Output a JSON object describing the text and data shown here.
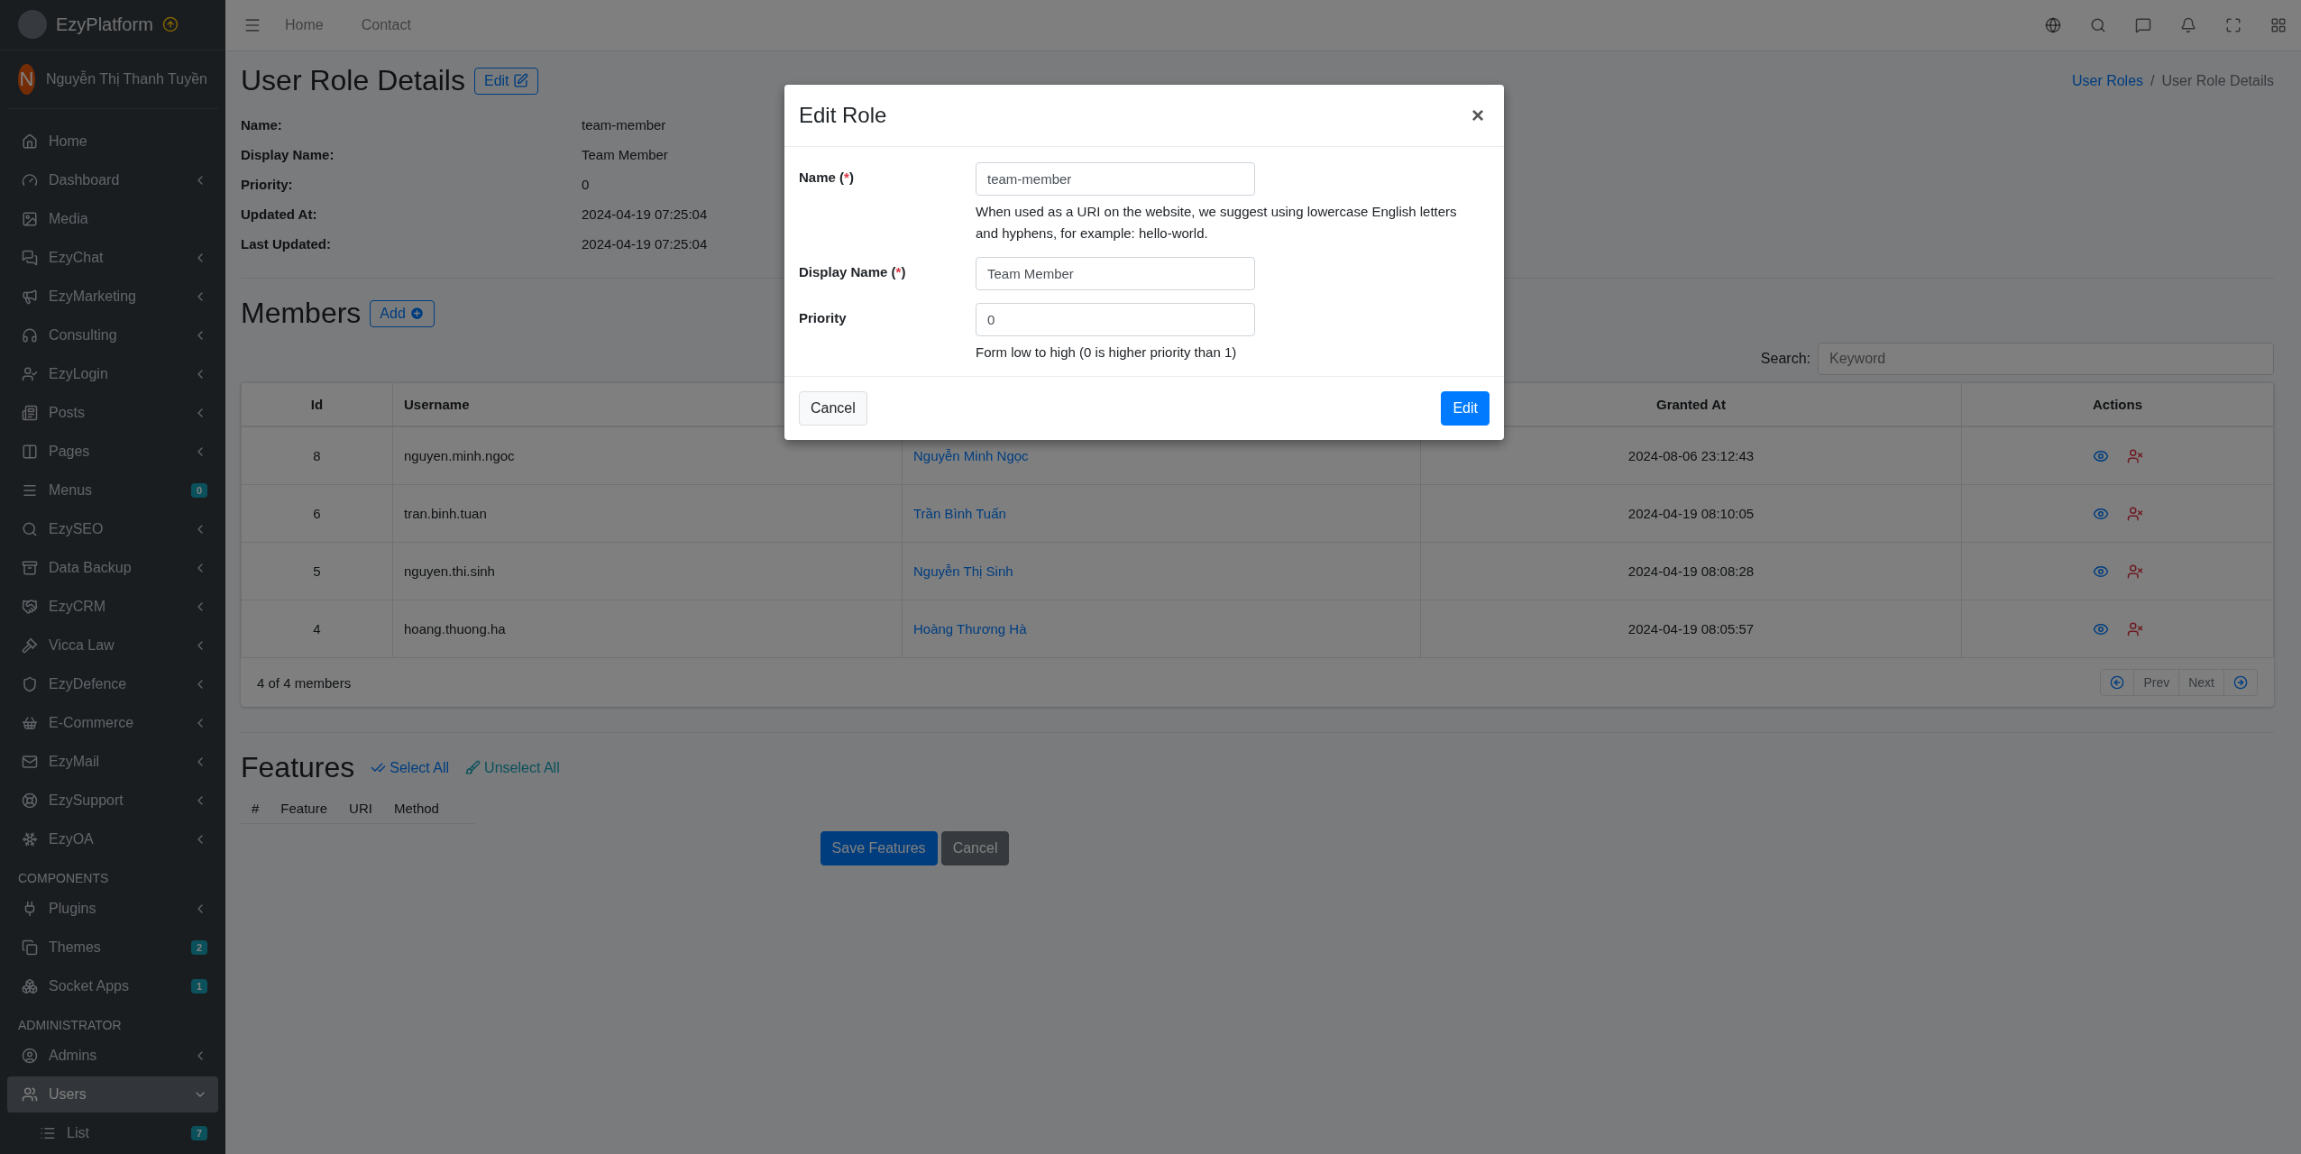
{
  "sidebar": {
    "brand": "EzyPlatform",
    "user": {
      "initial": "N",
      "name": "Nguyễn Thị Thanh Tuyền"
    },
    "groups": [
      {
        "items": [
          {
            "label": "Home",
            "expandable": false,
            "selected": false
          },
          {
            "label": "Dashboard",
            "expandable": true,
            "expanded": false,
            "selected": false
          },
          {
            "label": "Media",
            "expandable": false,
            "selected": false
          },
          {
            "label": "EzyChat",
            "expandable": true,
            "expanded": false,
            "selected": false
          },
          {
            "label": "EzyMarketing",
            "expandable": true,
            "expanded": false,
            "selected": false
          },
          {
            "label": "Consulting",
            "expandable": true,
            "expanded": false,
            "selected": false
          },
          {
            "label": "EzyLogin",
            "expandable": true,
            "expanded": false,
            "selected": false
          },
          {
            "label": "Posts",
            "expandable": true,
            "expanded": false,
            "selected": false
          },
          {
            "label": "Pages",
            "expandable": true,
            "expanded": false,
            "selected": false
          },
          {
            "label": "Menus",
            "expandable": false,
            "badge": "0",
            "selected": false
          },
          {
            "label": "EzySEO",
            "expandable": true,
            "expanded": false,
            "selected": false
          },
          {
            "label": "Data Backup",
            "expandable": true,
            "expanded": false,
            "selected": false
          },
          {
            "label": "EzyCRM",
            "expandable": true,
            "expanded": false,
            "selected": false
          },
          {
            "label": "Vicca Law",
            "expandable": true,
            "expanded": false,
            "selected": false
          },
          {
            "label": "EzyDefence",
            "expandable": true,
            "expanded": false,
            "selected": false
          },
          {
            "label": "E-Commerce",
            "expandable": true,
            "expanded": false,
            "selected": false
          },
          {
            "label": "EzyMail",
            "expandable": true,
            "expanded": false,
            "selected": false
          },
          {
            "label": "EzySupport",
            "expandable": true,
            "expanded": false,
            "selected": false
          },
          {
            "label": "EzyOA",
            "expandable": true,
            "expanded": false,
            "selected": false
          }
        ]
      },
      {
        "heading": "COMPONENTS",
        "items": [
          {
            "label": "Plugins",
            "expandable": true,
            "expanded": false,
            "selected": false
          },
          {
            "label": "Themes",
            "expandable": false,
            "badge": "2",
            "selected": false
          },
          {
            "label": "Socket Apps",
            "expandable": false,
            "badge": "1",
            "selected": false
          }
        ]
      },
      {
        "heading": "ADMINISTRATOR",
        "items": [
          {
            "label": "Admins",
            "expandable": true,
            "expanded": false,
            "selected": false
          },
          {
            "label": "Users",
            "expandable": true,
            "expanded": true,
            "selected": true,
            "children": [
              {
                "label": "List",
                "badge": "7"
              }
            ]
          }
        ]
      }
    ]
  },
  "topbar": {
    "links": [
      "Home",
      "Contact"
    ]
  },
  "breadcrumb": {
    "link": "User Roles",
    "separator": "/",
    "current": "User Role Details"
  },
  "page_title": "User Role Details",
  "edit_button": "Edit",
  "details": [
    {
      "label": "Name:",
      "value": "team-member"
    },
    {
      "label": "Display Name:",
      "value": "Team Member"
    },
    {
      "label": "Priority:",
      "value": "0"
    },
    {
      "label": "Updated At:",
      "value": "2024-04-19 07:25:04"
    },
    {
      "label": "Last Updated:",
      "value": "2024-04-19 07:25:04"
    }
  ],
  "members": {
    "title": "Members",
    "add_button": "Add",
    "search_label": "Search:",
    "search_placeholder": "Keyword",
    "columns": [
      {
        "label": "Id"
      },
      {
        "label": "Username"
      },
      {},
      {
        "label": "Granted At"
      },
      {
        "label": "Actions"
      }
    ],
    "rows": [
      {
        "id": "8",
        "username": "nguyen.minh.ngoc",
        "display_name": "Nguyễn Minh Ngọc",
        "granted_at": "2024-08-06 23:12:43"
      },
      {
        "id": "6",
        "username": "tran.binh.tuan",
        "display_name": "Trần Bình Tuấn",
        "granted_at": "2024-04-19 08:10:05"
      },
      {
        "id": "5",
        "username": "nguyen.thi.sinh",
        "display_name": "Nguyễn Thị Sinh",
        "granted_at": "2024-04-19 08:08:28"
      },
      {
        "id": "4",
        "username": "hoang.thuong.ha",
        "display_name": "Hoàng Thương Hà",
        "granted_at": "2024-04-19 08:05:57"
      }
    ],
    "count": "4 of 4 members",
    "prev": "Prev",
    "next": "Next"
  },
  "features": {
    "title": "Features",
    "select_all": "Select All",
    "unselect_all": "Unselect All",
    "columns": [
      "#",
      "Feature",
      "URI",
      "Method"
    ],
    "save_button": "Save Features",
    "cancel_button": "Cancel"
  },
  "modal": {
    "title": "Edit Role",
    "close": "×",
    "fields": [
      {
        "label": "Name (",
        "required_mark": "*",
        "label_close": ")",
        "value": "team-member",
        "help": "When used as a URI on the website, we suggest using lowercase English letters and hyphens, for example: hello-world."
      },
      {
        "label": "Display Name (",
        "required_mark": "*",
        "label_close": ")",
        "value": "Team Member"
      },
      {
        "label": "Priority",
        "value": "0",
        "help": "Form low to high (0 is higher priority than 1)"
      }
    ],
    "cancel_button": "Cancel",
    "submit_button": "Edit"
  }
}
